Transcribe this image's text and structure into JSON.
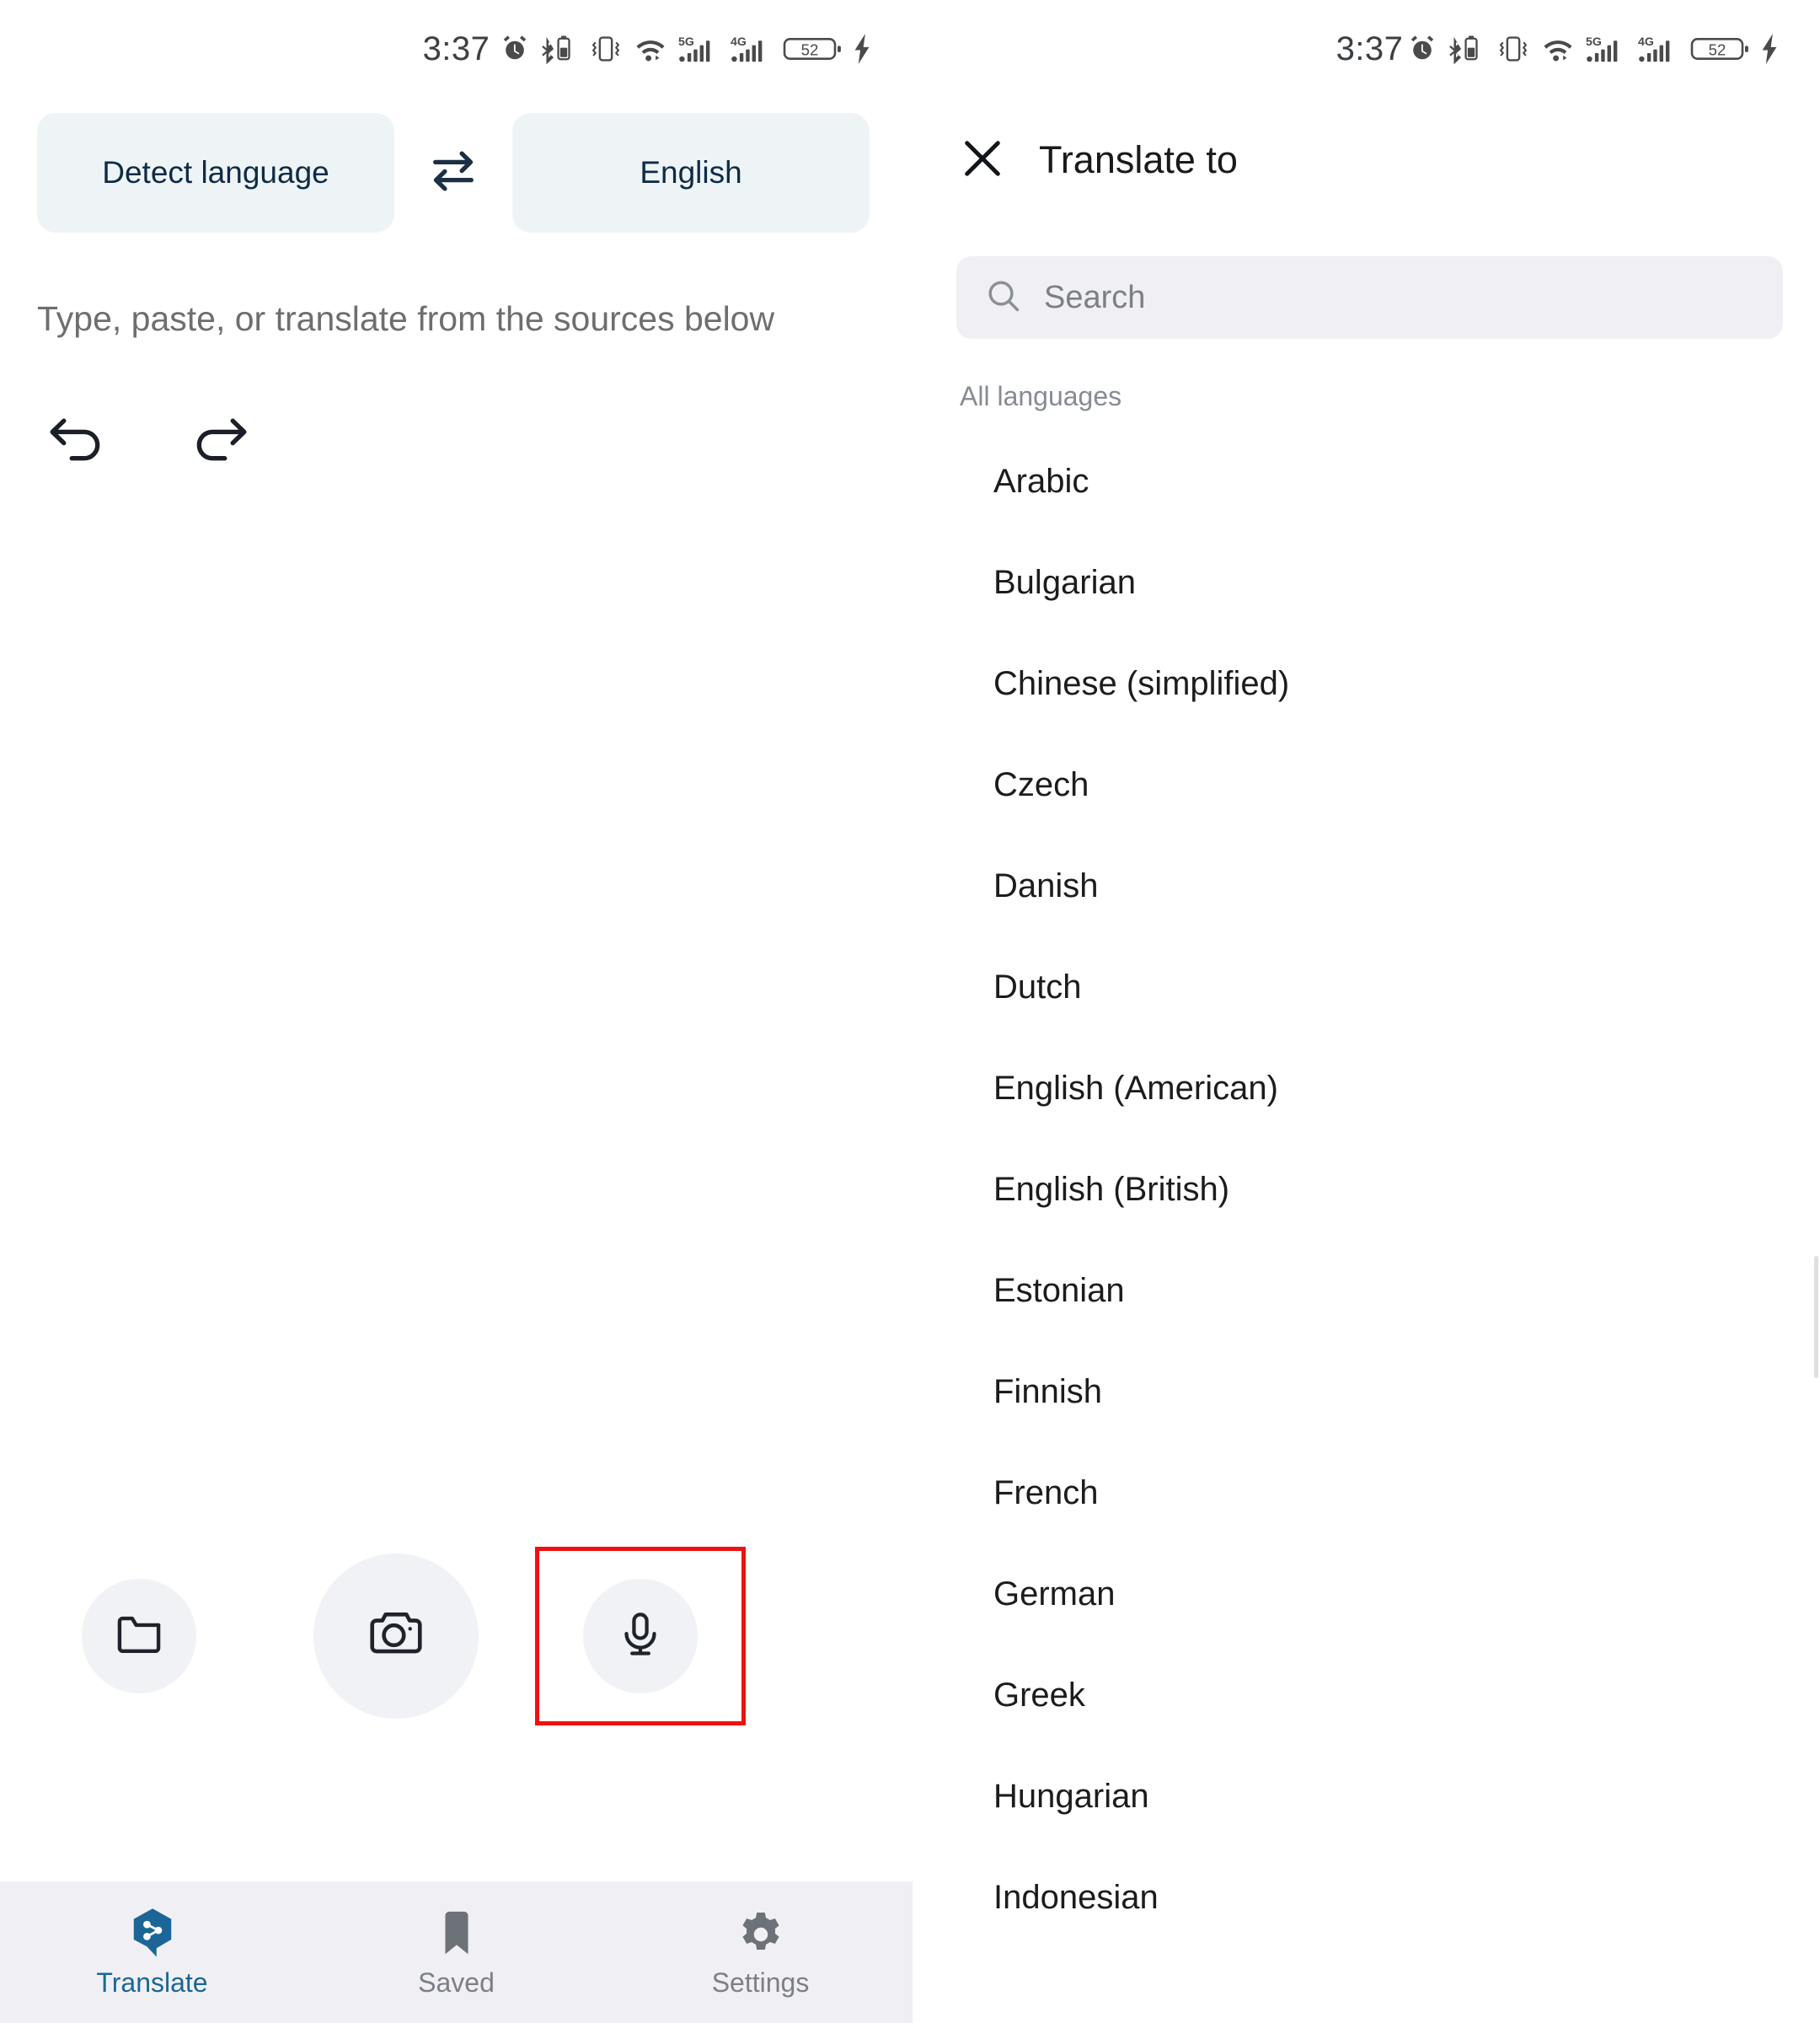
{
  "status_bar": {
    "time": "3:37",
    "battery_level": "52",
    "network_primary": "5G",
    "network_secondary": "4G",
    "icons": [
      "alarm-icon",
      "bluetooth-battery-icon",
      "vibrate-icon",
      "wifi-icon",
      "signal-5g-icon",
      "signal-4g-icon",
      "battery-icon",
      "charging-bolt-icon"
    ]
  },
  "left_panel": {
    "source_language_label": "Detect language",
    "target_language_label": "English",
    "swap_icon": "swap-arrows-icon",
    "source_placeholder": "Type, paste, or translate from the sources below",
    "undo_icon": "undo-icon",
    "redo_icon": "redo-icon",
    "actions": [
      {
        "name": "folder-button",
        "icon": "folder-icon"
      },
      {
        "name": "camera-button",
        "icon": "camera-icon"
      },
      {
        "name": "microphone-button",
        "icon": "microphone-icon",
        "highlighted": true
      }
    ],
    "highlight_color": "#ee1111",
    "chip_background": "#eef4f6",
    "circle_background": "#f1f2f5"
  },
  "bottom_nav": {
    "background": "#f0f0f4",
    "active_color": "#1b6696",
    "inactive_color": "#7c7f87",
    "items": [
      {
        "label": "Translate",
        "icon": "translate-logo-icon",
        "active": true
      },
      {
        "label": "Saved",
        "icon": "bookmark-icon",
        "active": false
      },
      {
        "label": "Settings",
        "icon": "gear-icon",
        "active": false
      }
    ]
  },
  "right_panel": {
    "close_icon": "close-icon",
    "title": "Translate to",
    "search": {
      "icon": "search-icon",
      "placeholder": "Search",
      "value": ""
    },
    "section_label": "All languages",
    "languages": [
      "Arabic",
      "Bulgarian",
      "Chinese (simplified)",
      "Czech",
      "Danish",
      "Dutch",
      "English (American)",
      "English (British)",
      "Estonian",
      "Finnish",
      "French",
      "German",
      "Greek",
      "Hungarian",
      "Indonesian"
    ]
  }
}
